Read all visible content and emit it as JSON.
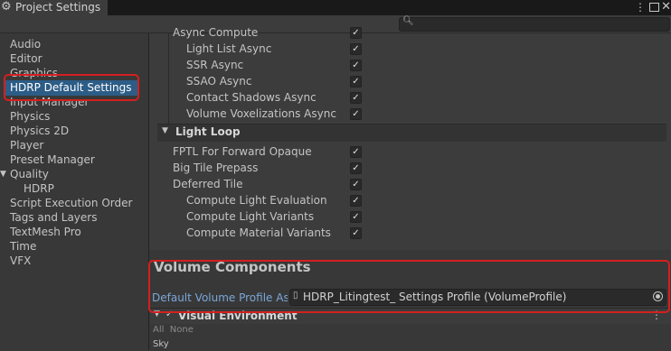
{
  "window": {
    "tab_title": "Project Settings",
    "gear_icon": "gear-icon",
    "controls": [
      "kebab-menu-icon",
      "maximize-icon",
      "close-icon"
    ]
  },
  "toolbar": {
    "search_placeholder": "",
    "search_icon": "search-icon"
  },
  "sidebar": {
    "items": [
      {
        "label": "Audio"
      },
      {
        "label": "Editor"
      },
      {
        "label": "Graphics"
      },
      {
        "label": "HDRP Default Settings",
        "selected": true
      },
      {
        "label": "Input Manager"
      },
      {
        "label": "Physics"
      },
      {
        "label": "Physics 2D"
      },
      {
        "label": "Player"
      },
      {
        "label": "Preset Manager"
      },
      {
        "label": "Quality",
        "expanded": true
      },
      {
        "label": "HDRP",
        "child": true
      },
      {
        "label": "Script Execution Order"
      },
      {
        "label": "Tags and Layers"
      },
      {
        "label": "TextMesh Pro"
      },
      {
        "label": "Time"
      },
      {
        "label": "VFX"
      }
    ]
  },
  "main": {
    "async_compute_header": "Async Compute",
    "async_rows": [
      {
        "label": "Light List Async",
        "checked": true
      },
      {
        "label": "SSR Async",
        "checked": true
      },
      {
        "label": "SSAO Async",
        "checked": true
      },
      {
        "label": "Contact Shadows Async",
        "checked": true
      },
      {
        "label": "Volume Voxelizations Async",
        "checked": true
      }
    ],
    "light_loop": {
      "title": "Light Loop",
      "rows": [
        {
          "label": "FPTL For Forward Opaque",
          "checked": true
        },
        {
          "label": "Big Tile Prepass",
          "checked": true
        },
        {
          "label": "Deferred Tile",
          "checked": true
        },
        {
          "label": "Compute Light Evaluation",
          "checked": true
        },
        {
          "label": "Compute Light Variants",
          "checked": true
        },
        {
          "label": "Compute Material Variants",
          "checked": true
        }
      ]
    },
    "volume_components": {
      "title": "Volume Components",
      "profile_label": "Default Volume Profile Ass",
      "profile_value": "HDRP_Litingtest_ Settings Profile (VolumeProfile)"
    },
    "visual_environment": {
      "title": "Visual Environment",
      "all_label": "All",
      "none_label": "None",
      "sky_label": "Sky"
    }
  },
  "colors": {
    "highlight_red": "#d51f1f",
    "selection_blue": "#2c5d87",
    "link_blue": "#7aa8d8"
  }
}
